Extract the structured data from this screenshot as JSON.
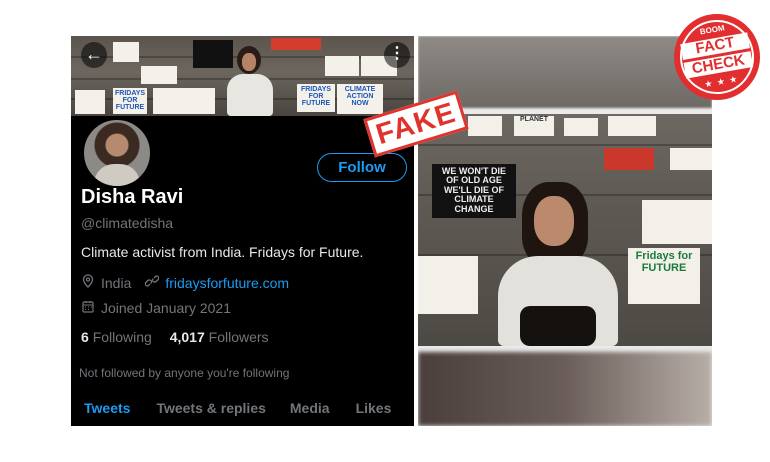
{
  "profile": {
    "name": "Disha Ravi",
    "handle": "@climatedisha",
    "bio": "Climate activist from India. Fridays for Future.",
    "location": "India",
    "website": "fridaysforfuture.com",
    "joined": "Joined January 2021",
    "following_count": "6",
    "following_label": "Following",
    "followers_count": "4,017",
    "followers_label": "Followers",
    "not_followed_text": "Not followed by anyone you're following",
    "follow_button": "Follow",
    "back_glyph": "←",
    "more_glyph": "⋮"
  },
  "tabs": [
    {
      "label": "Tweets",
      "active": true
    },
    {
      "label": "Tweets & replies",
      "active": false
    },
    {
      "label": "Media",
      "active": false
    },
    {
      "label": "Likes",
      "active": false
    }
  ],
  "banner_signs": {
    "fridays": "FRIDAYS FOR FUTURE",
    "climate_action": "CLIMATE ACTION NOW",
    "we_wont_die": "WE WON'T DIE OF OLD AGE WE'LL DIE OF CLIMATE CHANGE",
    "fridays_for_future": "Fridays for FUTURE",
    "planet": "PLANET"
  },
  "stamp": {
    "text": "FAKE"
  },
  "badge": {
    "brand": "BOOM",
    "line1": "FACT",
    "line2": "CHECK",
    "stars": "★ ★ ★"
  },
  "colors": {
    "accent": "#1d9bf0",
    "stamp_red": "#e0332d",
    "badge_red": "#e22e2e",
    "background": "#000000"
  },
  "icons": [
    "back-arrow-icon",
    "more-options-icon",
    "location-pin-icon",
    "link-icon",
    "calendar-icon"
  ]
}
